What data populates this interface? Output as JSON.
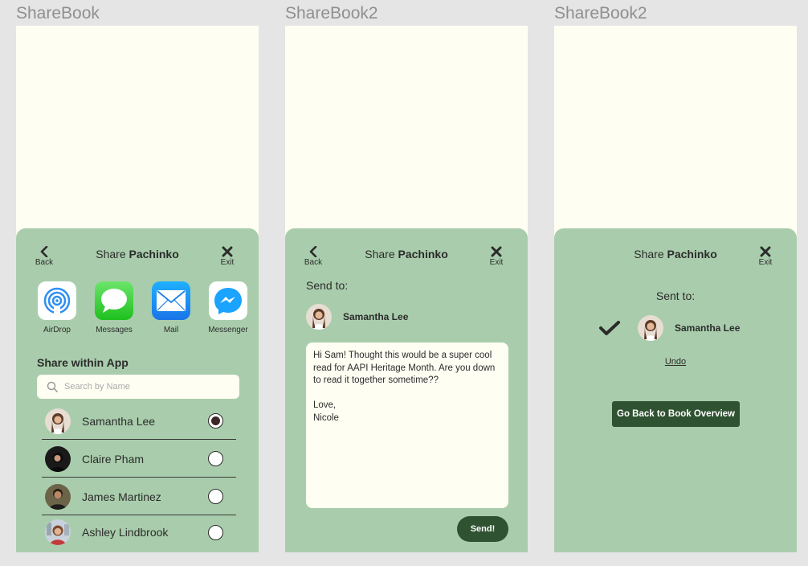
{
  "frames": [
    {
      "label": "ShareBook",
      "header": {
        "back_label": "Back",
        "title_prefix": "Share ",
        "title_book": "Pachinko",
        "exit_label": "Exit"
      },
      "apps": [
        {
          "name": "AirDrop",
          "icon": "airdrop-icon"
        },
        {
          "name": "Messages",
          "icon": "messages-icon"
        },
        {
          "name": "Mail",
          "icon": "mail-icon"
        },
        {
          "name": "Messenger",
          "icon": "messenger-icon"
        }
      ],
      "section_title": "Share within App",
      "search": {
        "placeholder": "Search by Name"
      },
      "contacts": [
        {
          "name": "Samantha Lee",
          "selected": true
        },
        {
          "name": "Claire Pham",
          "selected": false
        },
        {
          "name": "James Martinez",
          "selected": false
        },
        {
          "name": "Ashley Lindbrook",
          "selected": false
        }
      ]
    },
    {
      "label": "ShareBook2",
      "header": {
        "back_label": "Back",
        "title_prefix": "Share ",
        "title_book": "Pachinko",
        "exit_label": "Exit"
      },
      "send_to_label": "Send to:",
      "recipient": "Samantha Lee",
      "message": "Hi Sam! Thought this would be a super cool read for AAPI Heritage Month. Are you down to read it together sometime??\n\nLove,\nNicole",
      "send_label": "Send!"
    },
    {
      "label": "ShareBook2",
      "header": {
        "title_prefix": "Share ",
        "title_book": "Pachinko",
        "exit_label": "Exit"
      },
      "sent_to_label": "Sent to:",
      "recipient": "Samantha Lee",
      "undo_label": "Undo",
      "overview_label": "Go Back to Book Overview"
    }
  ],
  "colors": {
    "canvas": "#e5e5e5",
    "screen": "#fffef3",
    "sheet": "#a9cdac",
    "primary_button": "#2f5231",
    "text": "#2b2b2b"
  }
}
